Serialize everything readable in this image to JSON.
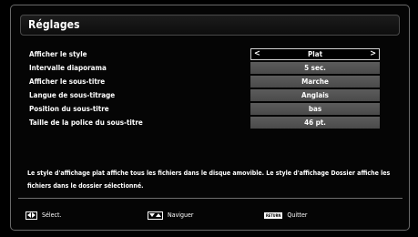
{
  "title": "Réglages",
  "settings": [
    {
      "label": "Afficher le style",
      "value": "Plat"
    },
    {
      "label": "Intervalle diaporama",
      "value": "5 sec."
    },
    {
      "label": "Afficher le sous-titre",
      "value": "Marche"
    },
    {
      "label": "Langue de sous-titrage",
      "value": "Anglais"
    },
    {
      "label": "Position du sous-titre",
      "value": "bas"
    },
    {
      "label": "Taille de la police du sous-titre",
      "value": "46 pt."
    }
  ],
  "arrows": {
    "left": "<",
    "right": ">"
  },
  "description": "Le style d'affichage plat affiche tous les fichiers dans le disque amovible. Le style d'affichage Dossier affiche les fichiers dans le dossier sélectionné.",
  "footer": {
    "select_label": "Sélect.",
    "navigate_label": "Naviguer",
    "return_key": "RETURN",
    "quit_label": "Quitter"
  },
  "icons": {
    "select": "left-right-arrows-icon",
    "navigate": "down-up-arrows-icon",
    "quit": "return-key-icon"
  }
}
